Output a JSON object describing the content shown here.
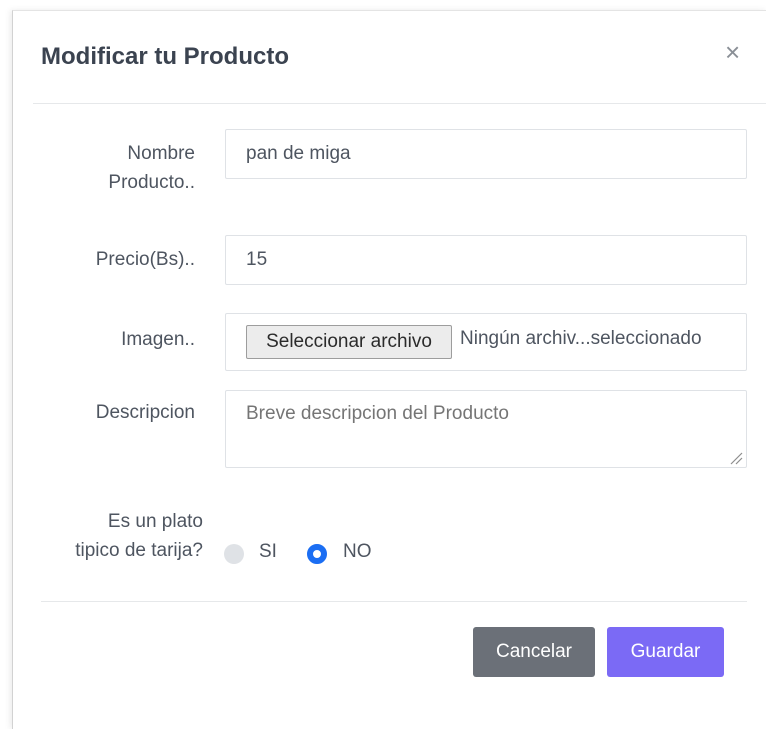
{
  "modal": {
    "title": "Modificar tu Producto",
    "close_icon": "×"
  },
  "form": {
    "nombre": {
      "label_line1": "Nombre",
      "label_line2": "Producto..",
      "value": "pan de miga"
    },
    "precio": {
      "label": "Precio(Bs)..",
      "value": "15"
    },
    "imagen": {
      "label": "Imagen..",
      "button_label": "Seleccionar archivo",
      "file_status": "Ningún archiv...seleccionado"
    },
    "descripcion": {
      "label": "Descripcion",
      "placeholder": "Breve descripcion del Producto"
    },
    "plato_tipico": {
      "label_line1": "Es un plato",
      "label_line2": "tipico de tarija?",
      "options": [
        {
          "label": "SI",
          "selected": false
        },
        {
          "label": "NO",
          "selected": true
        }
      ]
    }
  },
  "footer": {
    "cancel_label": "Cancelar",
    "save_label": "Guardar"
  },
  "colors": {
    "accent": "#7b6af5",
    "cancel": "#6b7078",
    "radio_selected": "#1b6ef3"
  }
}
